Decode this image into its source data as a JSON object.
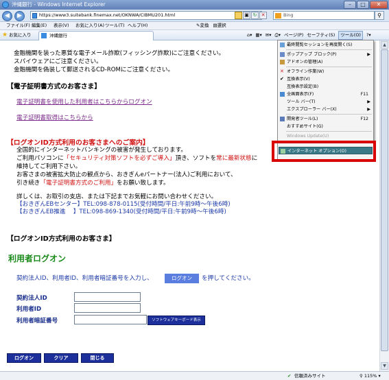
{
  "window": {
    "title": "沖縄銀行 - Windows Internet Explorer"
  },
  "address": {
    "url": "https://www3.suitebank.finemax.net/OKNWA/CIBMU201.html",
    "search_placeholder": "Bing"
  },
  "menubar": {
    "items": [
      "ファイル(F)",
      "編集(E)",
      "表示(V)",
      "お気に入り(A)",
      "ツール(T)",
      "ヘルプ(H)"
    ],
    "translate": "変換",
    "select": "選択"
  },
  "favbar": {
    "favorites": "お気に入り",
    "tab_title": "沖縄銀行",
    "cmd": [
      "ページ(P)",
      "セーフティ(S)",
      "ツール(O)"
    ]
  },
  "content": {
    "warn1": "金融機関を装った悪質な電子メール詐欺(フィッシング詐欺)にご注意ください。",
    "warn2": "スパイウェアにご注意ください。",
    "warn3": "金融機関を偽装して郵送されるCD-ROMにご注意ください。",
    "cert_heading": "【電子証明書方式のお客さま】",
    "cert_login_link": "電子証明書を使用した利用者はこちらからログオン",
    "cert_get_link": "電子証明書取得はこちらから",
    "notice_heading": "【ログオンID方式利用のお客さまへのご案内】",
    "notice1": "全国的にインターネットバンキングの被害が発生しております。",
    "notice2_a": "ご利用パソコンに",
    "notice2_red": "「セキュリティ対策ソフトを必ずご導入」",
    "notice2_b": "頂き、ソフトを",
    "notice2_red2": "常に最新状態",
    "notice2_c": "に",
    "notice3": "維持してご利用下さい。",
    "notice4": "お客さまの被害拡大防止の観点から、おきぎんeパートナー(法人)ご利用において、",
    "notice5_a": "引き続き",
    "notice5_red": "「電子証明書方式のご利用」",
    "notice5_b": "をお願い致します。",
    "contact1": "詳しくは、お取引の支店、または下記までお気軽にお問い合わせください。",
    "contact2": "【おきぎんEBセンター】TEL:098-878-0115(受付時間/平日:午前9時〜午後6時)",
    "contact3": "【おきぎんEB推進　 】TEL:098-869-1340(受付時間/平日:午前9時〜午後6時)",
    "logon_heading": "【ログオンID方式利用のお客さま】",
    "user_login_title": "利用者ログオン",
    "instr_a": "契約法人ID、利用者ID、利用者暗証番号を入力し、",
    "instr_btn": "ログオン",
    "instr_b": "を押してください。",
    "label_corp_id": "契約法人ID",
    "label_user_id": "利用者ID",
    "label_password": "利用者暗証番号",
    "soft_keyboard": "ソフトウェアキーボード表示",
    "btn_logon": "ログオン",
    "btn_clear": "クリア",
    "btn_close": "閉じる"
  },
  "tools_menu": {
    "items": [
      {
        "label": "最終閲覧セッションを再度開く(S)"
      },
      {
        "label": "ポップアップ ブロック(P)"
      },
      {
        "label": "アドオンの管理(A)"
      },
      {
        "label": "オフライン作業(W)"
      },
      {
        "label": "互換表示(V)"
      },
      {
        "label": "互換表示設定(B)"
      },
      {
        "label": "全画面表示(F)",
        "shortcut": "F11"
      },
      {
        "label": "ツール バー(T)"
      },
      {
        "label": "エクスプローラー バー(X)"
      },
      {
        "label": "開発者ツール(L)",
        "shortcut": "F12"
      },
      {
        "label": "おすすめサイト(G)"
      },
      {
        "label": "Windows Update(U)"
      },
      {
        "label": "インターネット オプション(O)"
      }
    ]
  },
  "statusbar": {
    "zone": "信頼済みサイト",
    "zoom": "115%"
  }
}
